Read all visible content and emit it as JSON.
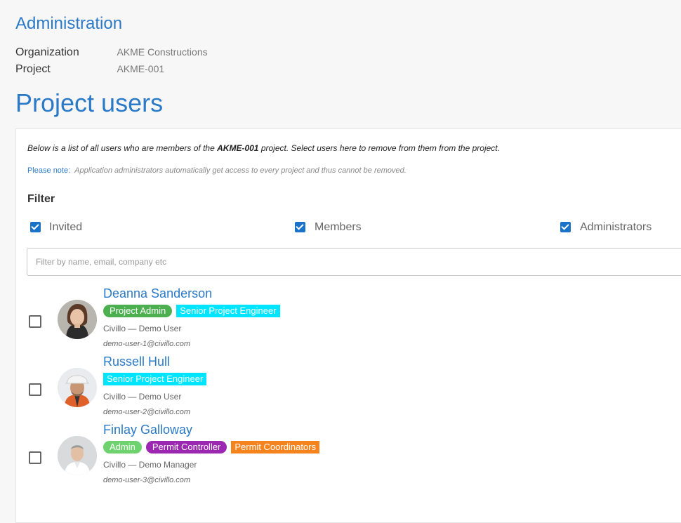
{
  "header": {
    "admin_title": "Administration",
    "organization_label": "Organization",
    "organization_value": "AKME Constructions",
    "project_label": "Project",
    "project_value": "AKME-001",
    "page_title": "Project users"
  },
  "intro": {
    "before": "Below is a list of all users who are members of the ",
    "project": "AKME-001",
    "after": " project. Select users here to remove from them from the project."
  },
  "note": {
    "label": "Please note:",
    "text": "Application administrators automatically get access to every project and thus cannot be removed."
  },
  "filter": {
    "heading": "Filter",
    "options": [
      {
        "label": "Invited",
        "checked": true
      },
      {
        "label": "Members",
        "checked": true
      },
      {
        "label": "Administrators",
        "checked": true
      }
    ],
    "placeholder": "Filter by name, email, company etc",
    "value": ""
  },
  "users": [
    {
      "name": "Deanna Sanderson",
      "checked": false,
      "tags": [
        {
          "label": "Project Admin",
          "color": "#4caf50",
          "shape": "pill",
          "text_color": "#ffffff"
        },
        {
          "label": "Senior Project Engineer",
          "color": "#00e5ff",
          "shape": "square",
          "text_color": "#ffffff"
        }
      ],
      "company": "Civillo — Demo User",
      "email": "demo-user-1@civillo.com"
    },
    {
      "name": "Russell Hull",
      "checked": false,
      "tags": [
        {
          "label": "Senior Project Engineer",
          "color": "#00e5ff",
          "shape": "square",
          "text_color": "#ffffff"
        }
      ],
      "company": "Civillo — Demo User",
      "email": "demo-user-2@civillo.com"
    },
    {
      "name": "Finlay Galloway",
      "checked": false,
      "tags": [
        {
          "label": "Admin",
          "color": "#6ed36e",
          "shape": "pill",
          "text_color": "#ffffff"
        },
        {
          "label": "Permit Controller",
          "color": "#9c27b0",
          "shape": "pill",
          "text_color": "#ffffff"
        },
        {
          "label": "Permit Coordinators",
          "color": "#f5841f",
          "shape": "square",
          "text_color": "#ffffff"
        }
      ],
      "company": "Civillo — Demo Manager",
      "email": "demo-user-3@civillo.com"
    }
  ],
  "colors": {
    "accent": "#2a7ac8",
    "checkbox": "#1a73c8"
  }
}
